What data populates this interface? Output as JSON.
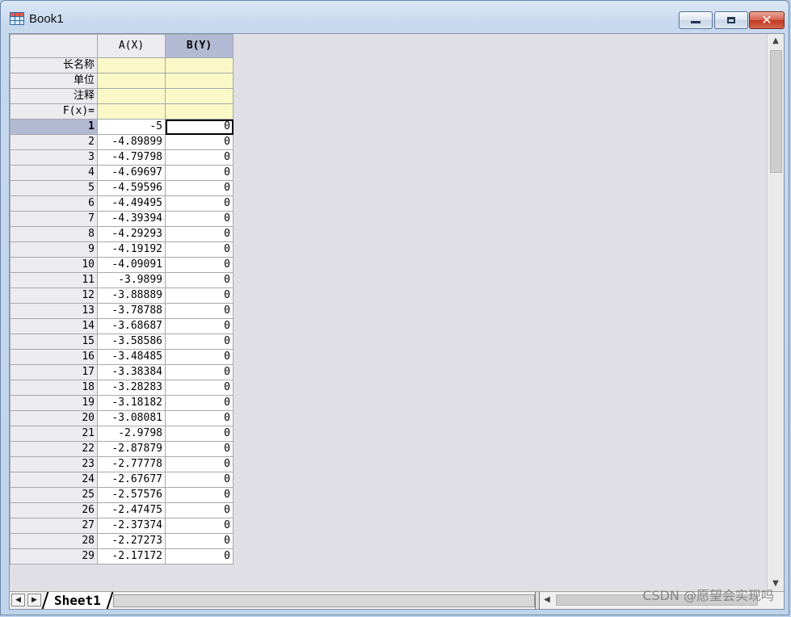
{
  "window": {
    "title": "Book1",
    "minimize_label": "",
    "maximize_label": "",
    "close_label": "✕"
  },
  "columns": [
    {
      "header": "A(X)",
      "selected": false
    },
    {
      "header": "B(Y)",
      "selected": true
    }
  ],
  "meta_rows": [
    "长名称",
    "单位",
    "注释",
    "F(x)="
  ],
  "rows": [
    {
      "n": "1",
      "a": "-5",
      "b": "0"
    },
    {
      "n": "2",
      "a": "-4.89899",
      "b": "0"
    },
    {
      "n": "3",
      "a": "-4.79798",
      "b": "0"
    },
    {
      "n": "4",
      "a": "-4.69697",
      "b": "0"
    },
    {
      "n": "5",
      "a": "-4.59596",
      "b": "0"
    },
    {
      "n": "6",
      "a": "-4.49495",
      "b": "0"
    },
    {
      "n": "7",
      "a": "-4.39394",
      "b": "0"
    },
    {
      "n": "8",
      "a": "-4.29293",
      "b": "0"
    },
    {
      "n": "9",
      "a": "-4.19192",
      "b": "0"
    },
    {
      "n": "10",
      "a": "-4.09091",
      "b": "0"
    },
    {
      "n": "11",
      "a": "-3.9899",
      "b": "0"
    },
    {
      "n": "12",
      "a": "-3.88889",
      "b": "0"
    },
    {
      "n": "13",
      "a": "-3.78788",
      "b": "0"
    },
    {
      "n": "14",
      "a": "-3.68687",
      "b": "0"
    },
    {
      "n": "15",
      "a": "-3.58586",
      "b": "0"
    },
    {
      "n": "16",
      "a": "-3.48485",
      "b": "0"
    },
    {
      "n": "17",
      "a": "-3.38384",
      "b": "0"
    },
    {
      "n": "18",
      "a": "-3.28283",
      "b": "0"
    },
    {
      "n": "19",
      "a": "-3.18182",
      "b": "0"
    },
    {
      "n": "20",
      "a": "-3.08081",
      "b": "0"
    },
    {
      "n": "21",
      "a": "-2.9798",
      "b": "0"
    },
    {
      "n": "22",
      "a": "-2.87879",
      "b": "0"
    },
    {
      "n": "23",
      "a": "-2.77778",
      "b": "0"
    },
    {
      "n": "24",
      "a": "-2.67677",
      "b": "0"
    },
    {
      "n": "25",
      "a": "-2.57576",
      "b": "0"
    },
    {
      "n": "26",
      "a": "-2.47475",
      "b": "0"
    },
    {
      "n": "27",
      "a": "-2.37374",
      "b": "0"
    },
    {
      "n": "28",
      "a": "-2.27273",
      "b": "0"
    },
    {
      "n": "29",
      "a": "-2.17172",
      "b": "0"
    }
  ],
  "active_row": "1",
  "sheet_tab": "Sheet1",
  "nav": {
    "prev": "◀",
    "next": "▶"
  },
  "scroll": {
    "up": "▲",
    "down": "▼",
    "left": "◀"
  },
  "watermark": "CSDN @愿望会实现吗",
  "colors": {
    "selected_header": "#b2b9d2",
    "meta_fill": "#fbf8c8",
    "client_bg": "#e0dfe5"
  }
}
